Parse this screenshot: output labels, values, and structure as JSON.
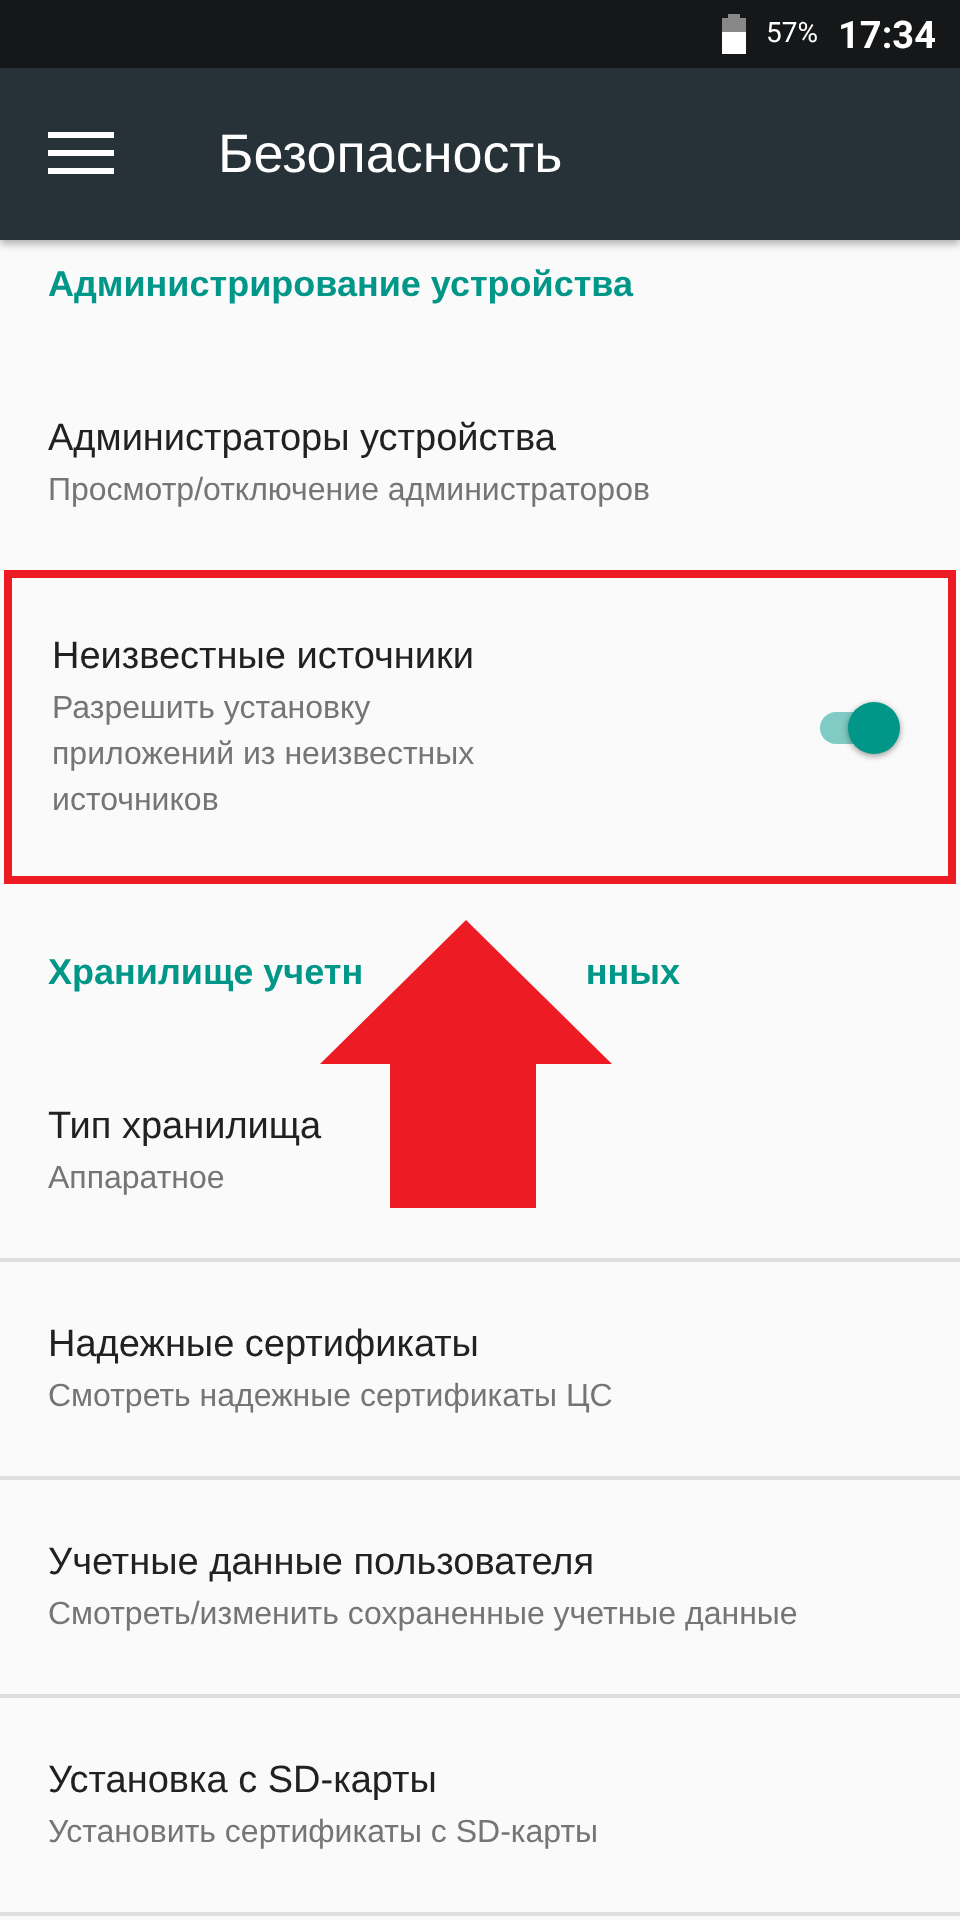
{
  "status_bar": {
    "battery": "57%",
    "time": "17:34"
  },
  "app_bar": {
    "title": "Безопасность"
  },
  "sections": [
    {
      "header_parts": [
        "Администрирование устройства"
      ],
      "items": [
        {
          "kind": "plain",
          "title": "Администраторы устройства",
          "subtitle": "Просмотр/отключение администраторов",
          "highlighted": false
        },
        {
          "kind": "switch",
          "title": "Неизвестные источники",
          "subtitle": "Разрешить установку приложений из неизвестных источников",
          "on": true,
          "highlighted": true
        }
      ]
    },
    {
      "header_parts": [
        "Хранилище учетн",
        "нных"
      ],
      "items": [
        {
          "kind": "plain",
          "title": "Тип хранилища",
          "subtitle": "Аппаратное",
          "highlighted": false
        },
        {
          "kind": "plain",
          "title": "Надежные сертификаты",
          "subtitle": "Смотреть надежные сертификаты ЦС",
          "highlighted": false
        },
        {
          "kind": "plain",
          "title": "Учетные данные пользователя",
          "subtitle": "Смотреть/изменить сохраненные учетные данные",
          "highlighted": false
        },
        {
          "kind": "plain",
          "title": "Установка с SD-карты",
          "subtitle": "Установить сертификаты с SD-карты",
          "highlighted": false
        }
      ]
    }
  ]
}
